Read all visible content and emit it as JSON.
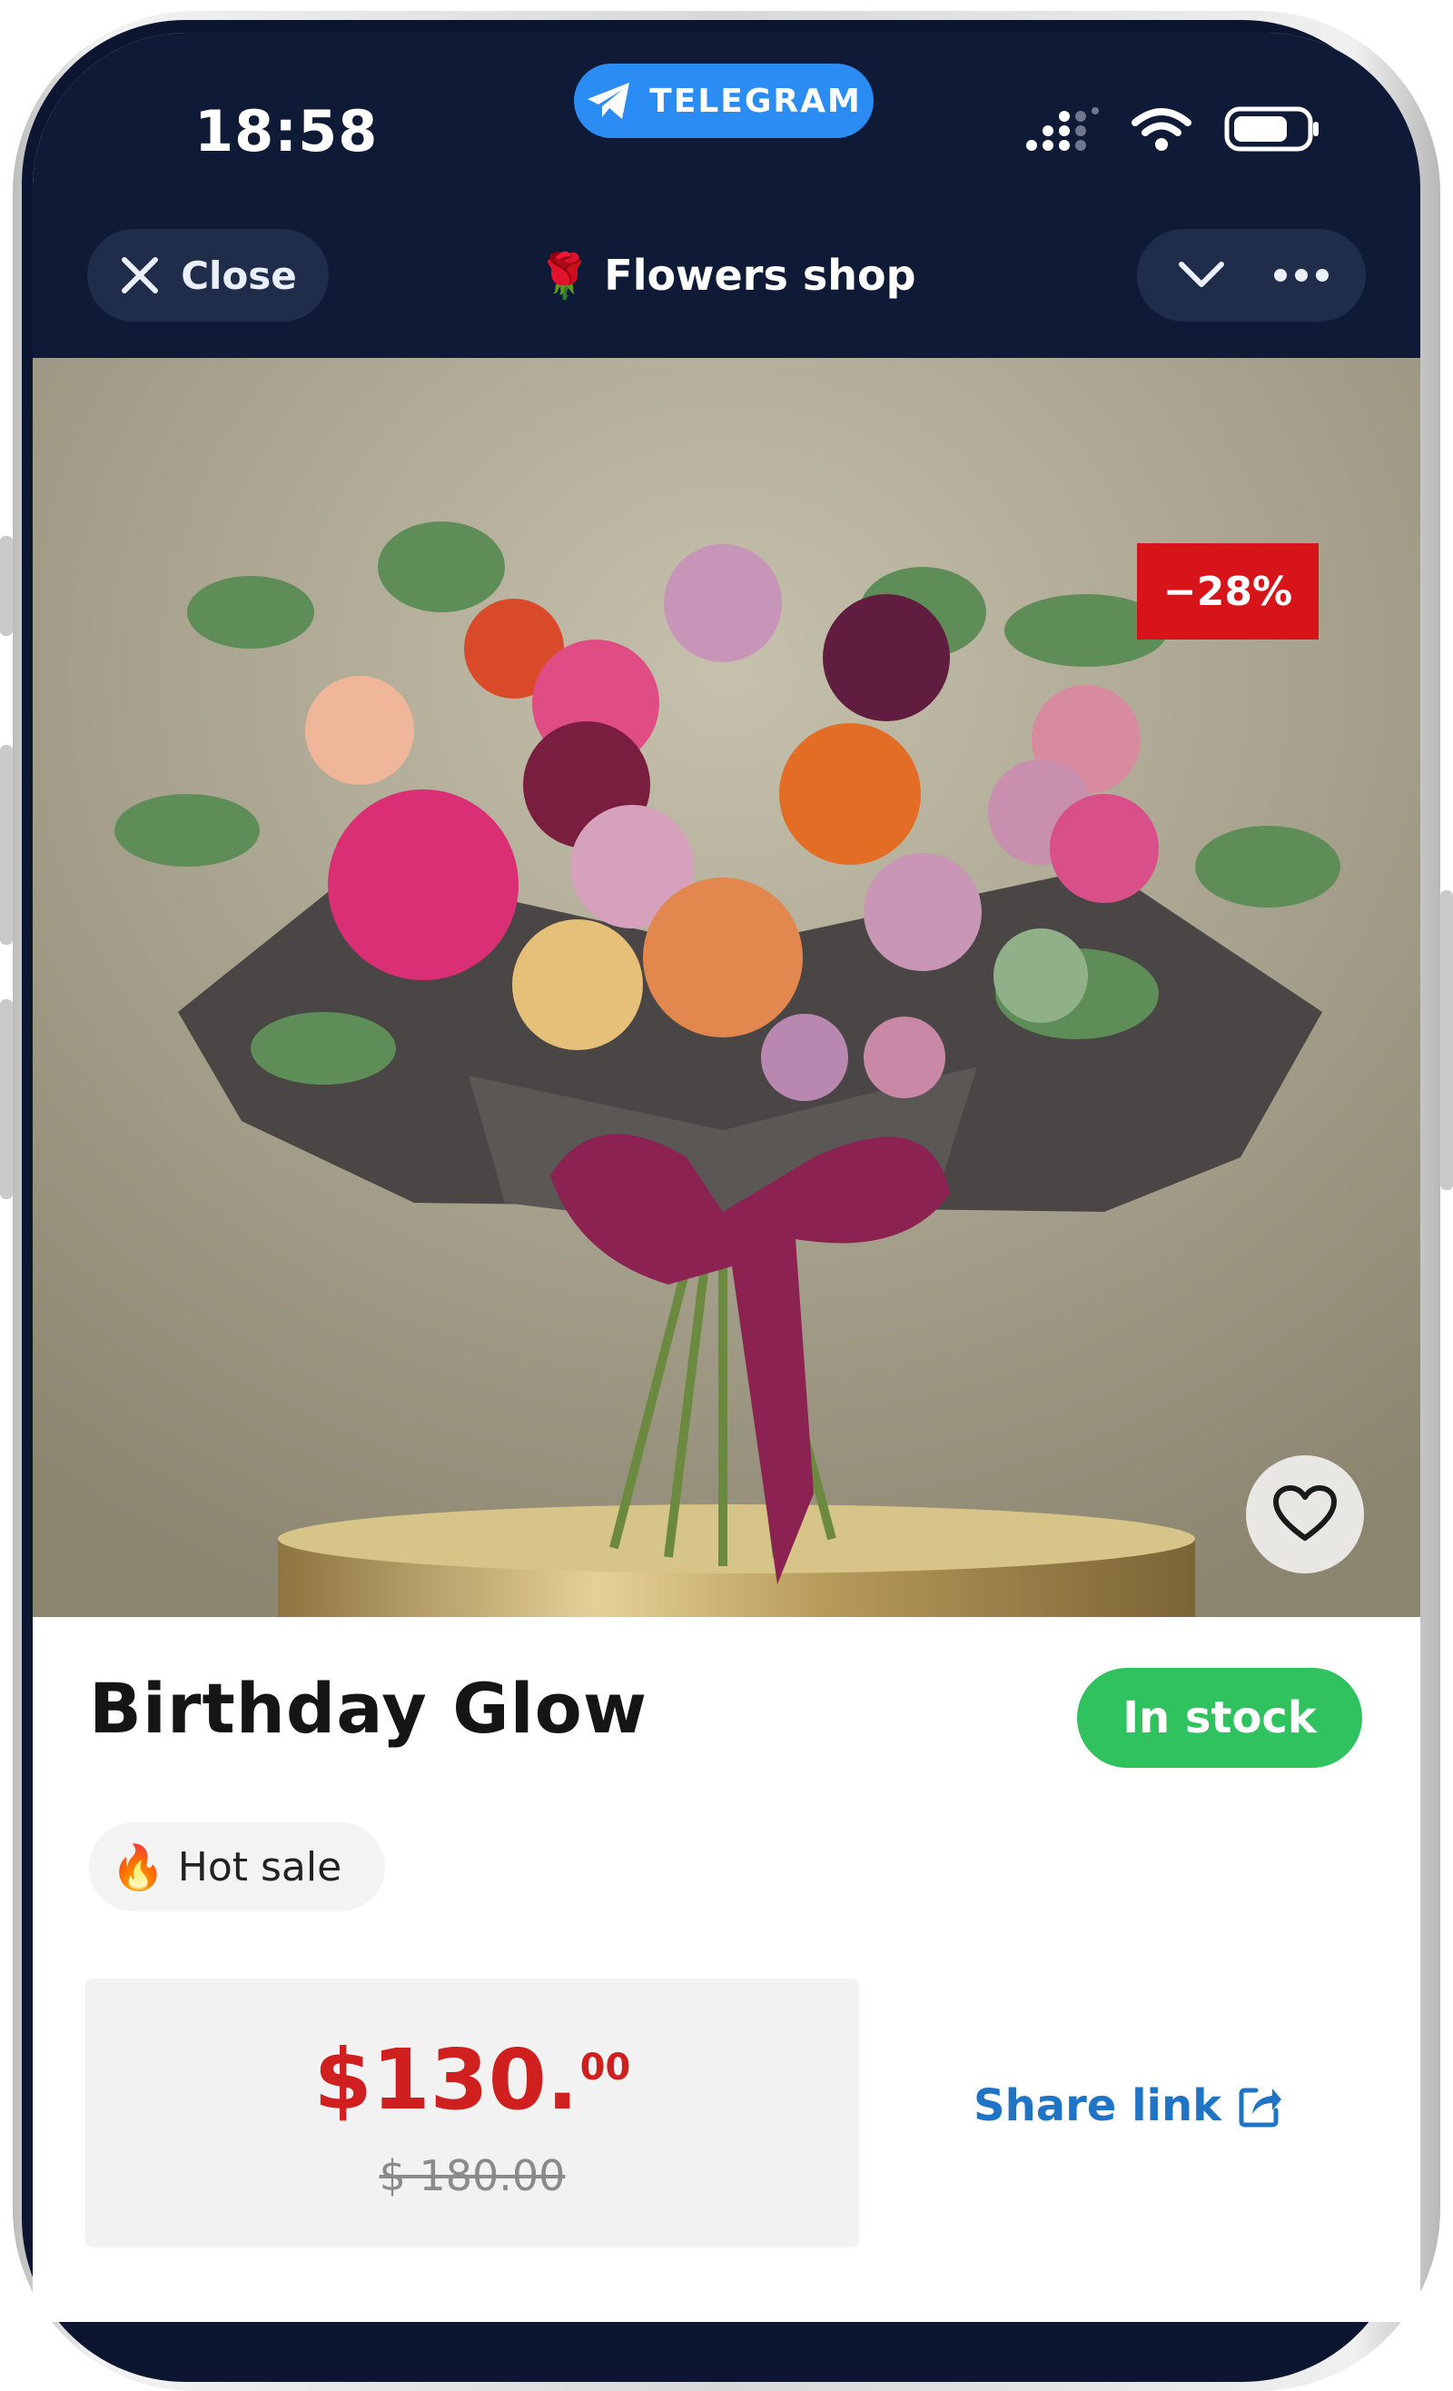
{
  "status_bar": {
    "time": "18:58",
    "telegram_label": "TELEGRAM"
  },
  "header": {
    "close_label": "Close",
    "title": "Flowers shop",
    "title_emoji": "🌹"
  },
  "product": {
    "discount": "−28%",
    "name": "Birthday Glow",
    "stock_status": "In stock",
    "hot_label": "Hot sale",
    "hot_emoji": "🔥",
    "price_main": "$130.",
    "price_cents": "00",
    "old_price": "$ 180.00",
    "share_label": "Share link"
  },
  "colors": {
    "header_bg": "#0e1a36",
    "telegram_blue": "#2b8cf4",
    "discount_red": "#d8141b",
    "stock_green": "#2fc25f",
    "price_red": "#cf1f1f",
    "link_blue": "#1f74c6"
  },
  "icons": [
    "telegram-icon",
    "signal-icon",
    "wifi-icon",
    "battery-icon",
    "close-icon",
    "chevron-down-icon",
    "more-icon",
    "heart-icon",
    "share-icon"
  ]
}
